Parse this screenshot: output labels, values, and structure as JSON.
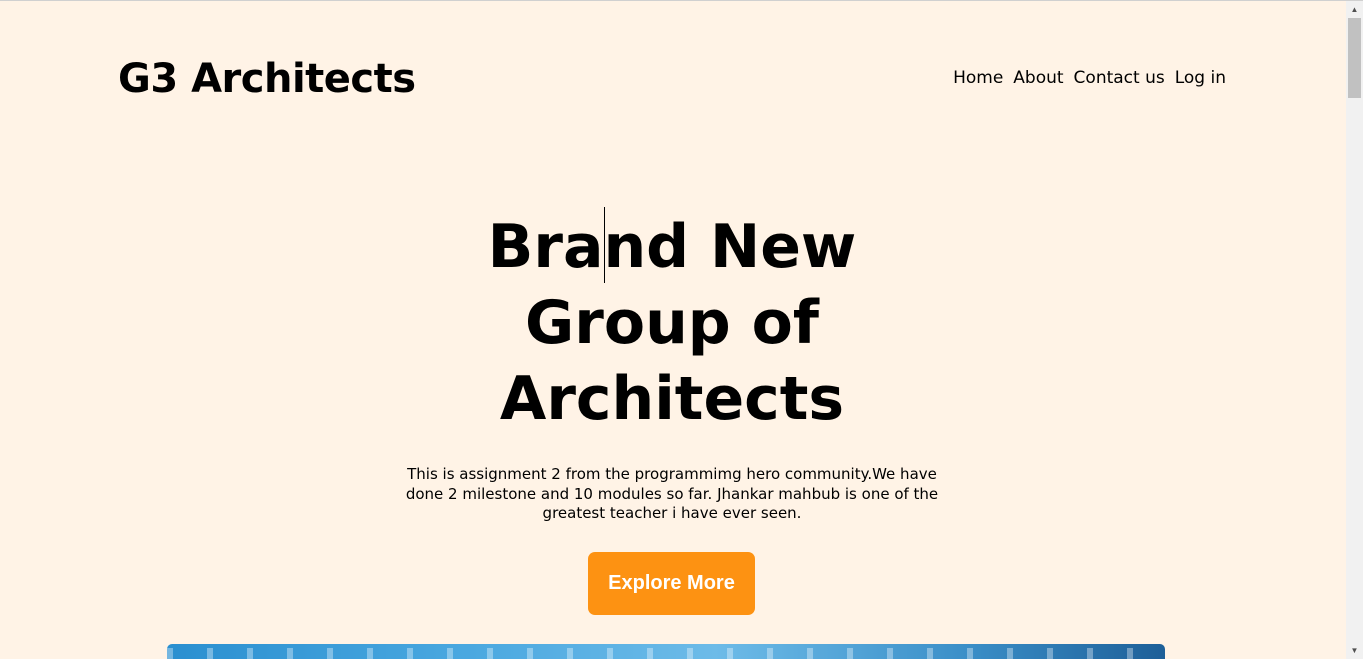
{
  "header": {
    "logo": "G3 Architects",
    "nav": [
      {
        "label": "Home"
      },
      {
        "label": "About"
      },
      {
        "label": "Contact us"
      },
      {
        "label": "Log in"
      }
    ]
  },
  "hero": {
    "title_lines": [
      "Brand New",
      "Group of",
      "Architects"
    ],
    "description": "This is assignment 2 from the programmimg hero community.We have done 2 milestone and 10 modules so far. Jhankar mahbub is one of the greatest teacher i have ever seen.",
    "cta_label": "Explore More"
  },
  "colors": {
    "background": "#fff3e6",
    "accent": "#fd9212"
  },
  "icons": {
    "scroll_up": "triangle-up-icon",
    "scroll_down": "triangle-down-icon"
  }
}
